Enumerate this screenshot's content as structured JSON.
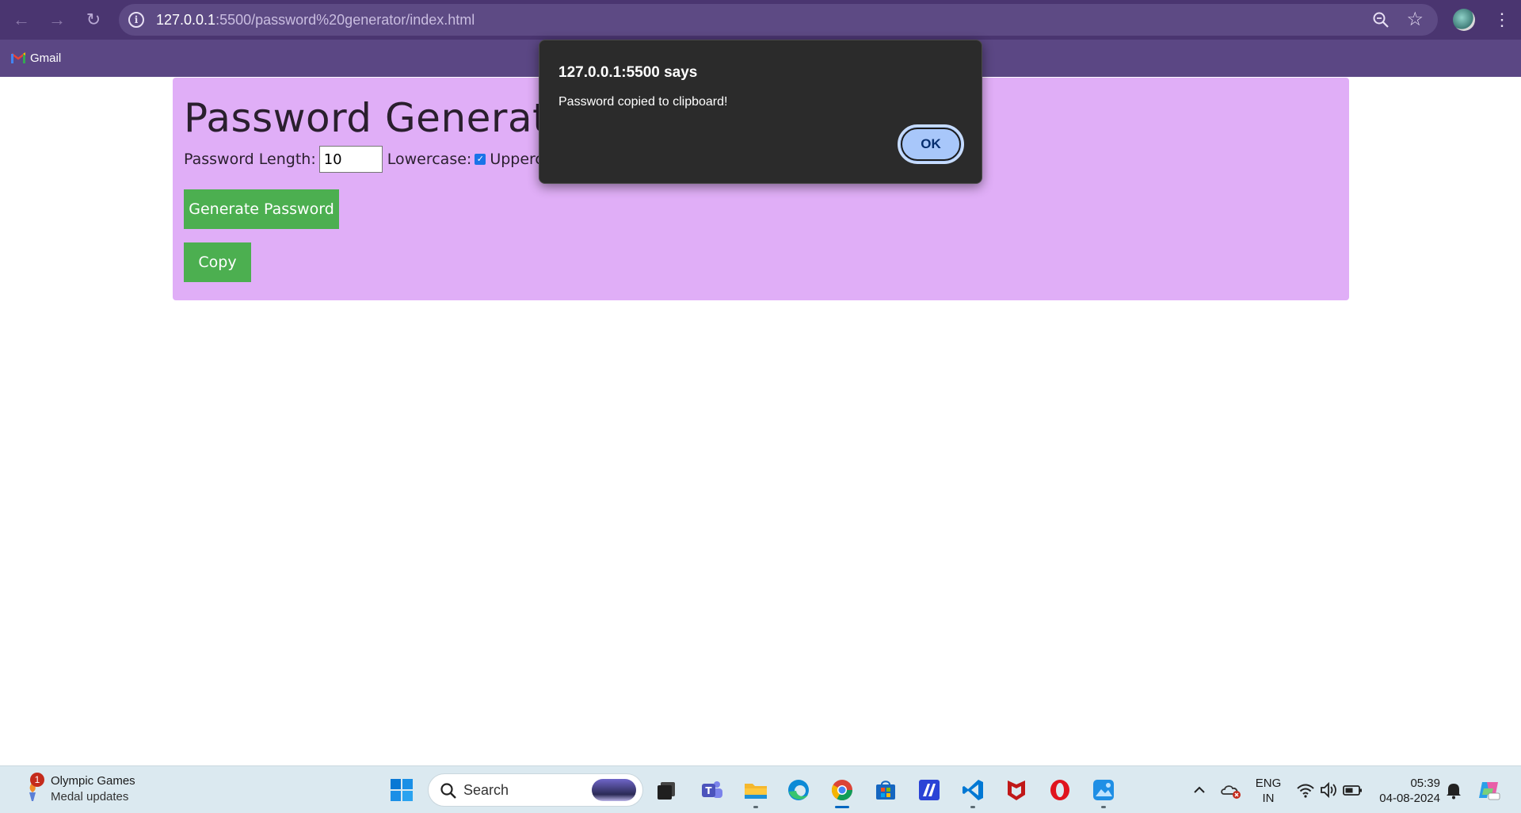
{
  "browser": {
    "url_host": "127.0.0.1",
    "url_rest": ":5500/password%20generator/index.html",
    "bookmark_gmail": "Gmail"
  },
  "page": {
    "title": "Password Generator",
    "length_label": "Password Length:",
    "length_value": "10",
    "lowercase_label": "Lowercase:",
    "uppercase_label": "Uppercase:",
    "lowercase_checked": true,
    "uppercase_checked": true,
    "generate_label": "Generate Password",
    "copy_label": "Copy"
  },
  "dialog": {
    "title": "127.0.0.1:5500 says",
    "message": "Password copied to clipboard!",
    "ok_label": "OK"
  },
  "taskbar": {
    "widget_badge": "1",
    "widget_title": "Olympic Games",
    "widget_subtitle": "Medal updates",
    "search_placeholder": "Search",
    "lang_line1": "ENG",
    "lang_line2": "IN",
    "time": "05:39",
    "date": "04-08-2024"
  },
  "colors": {
    "browser_frame": "#4a3570",
    "card_bg": "#e0aef7",
    "button_green": "#4caf50",
    "dialog_bg": "#2b2b2b",
    "ok_button": "#a8c7fa"
  }
}
